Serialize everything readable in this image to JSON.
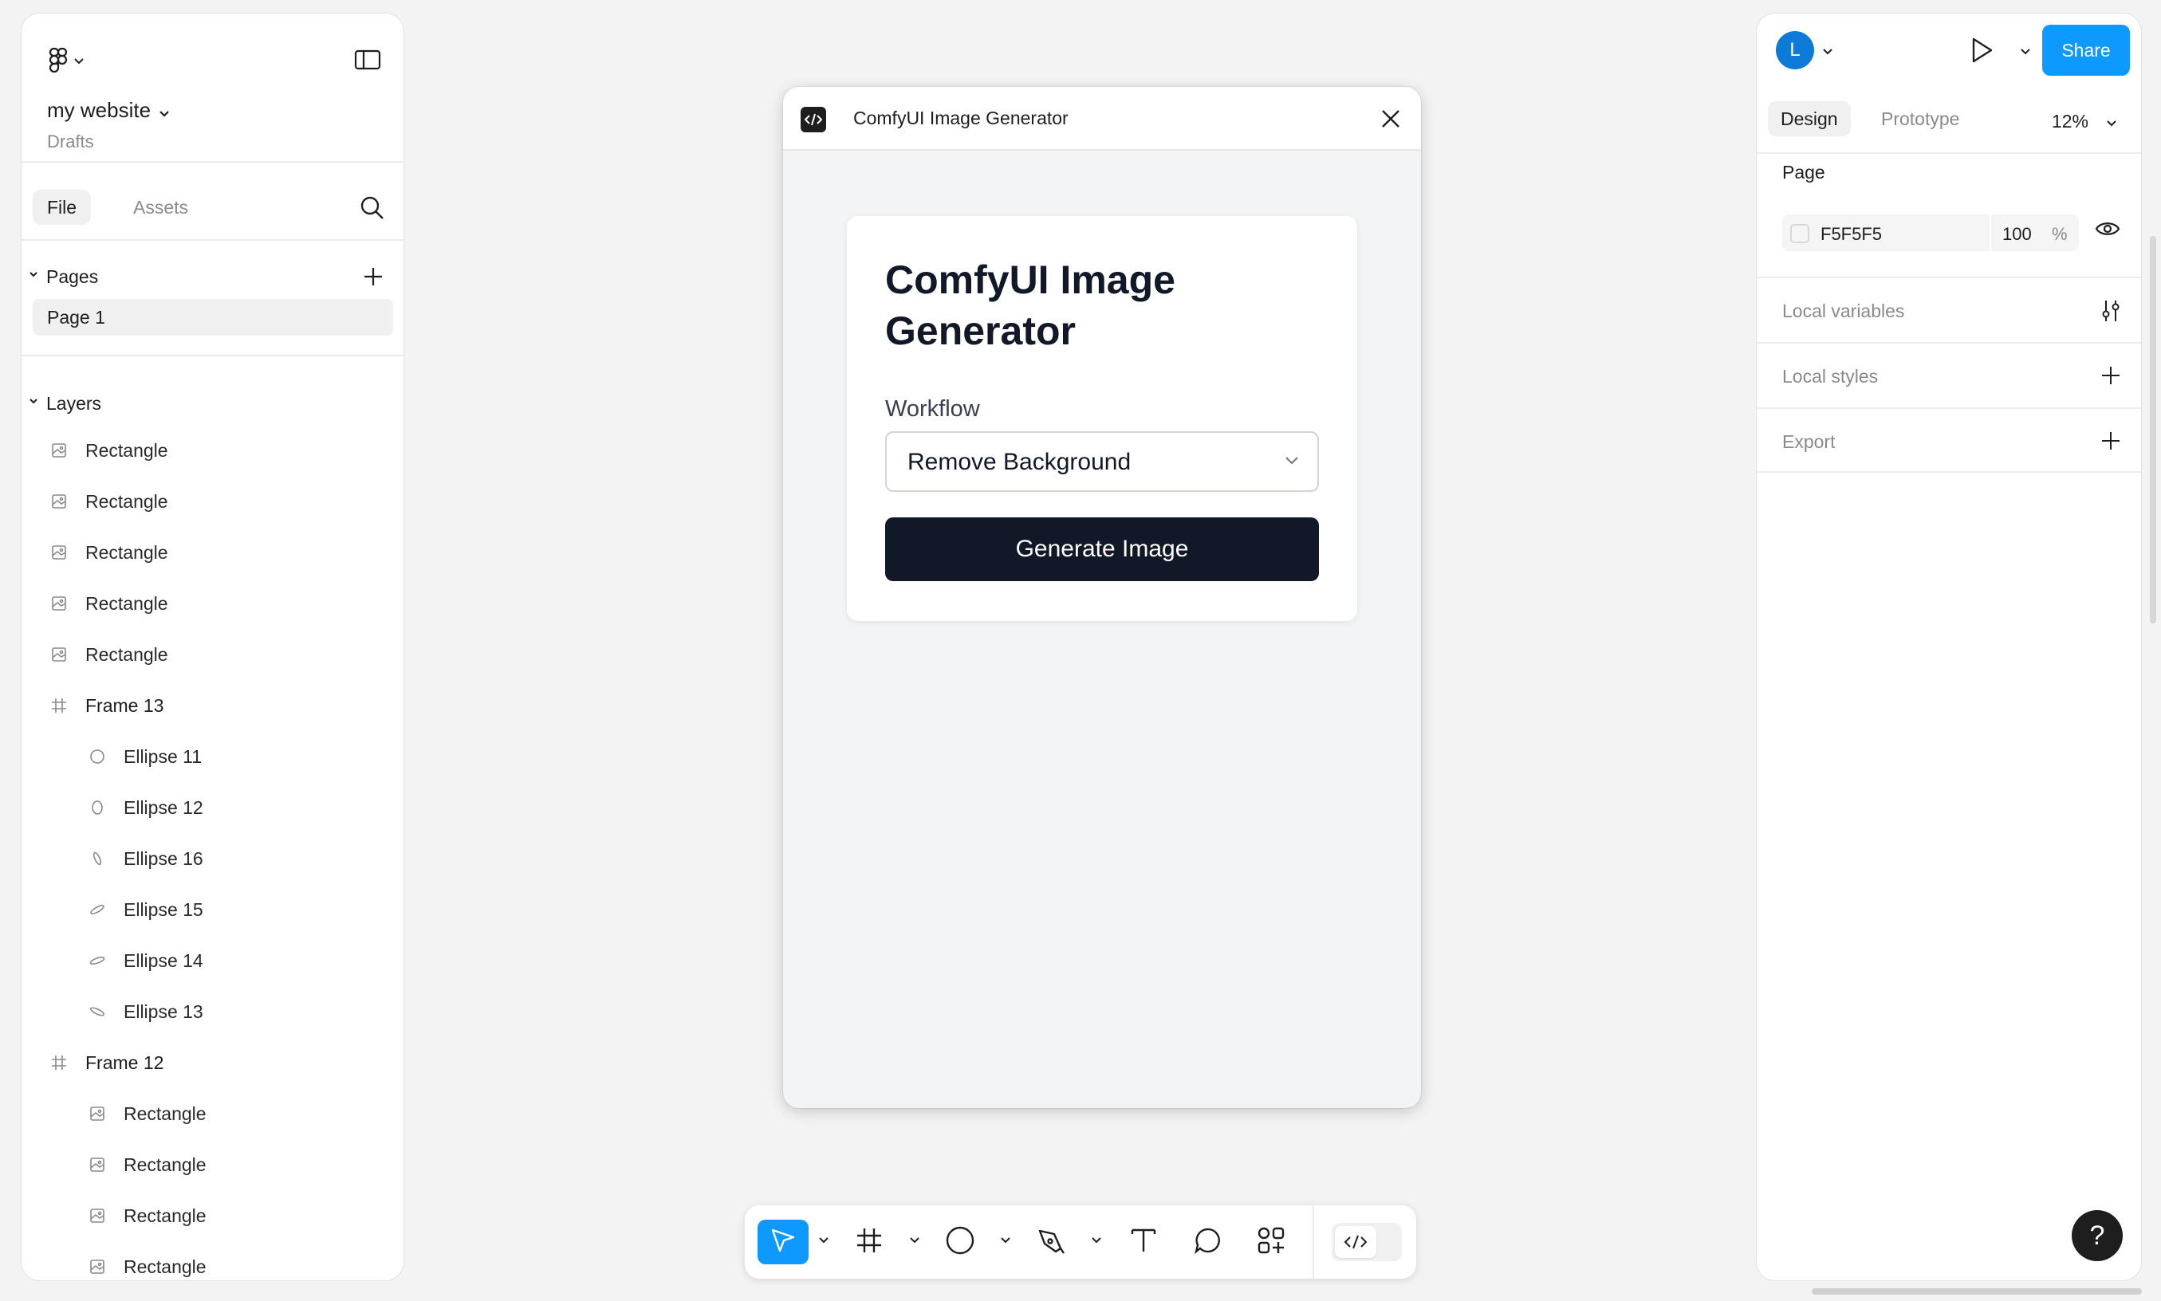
{
  "left_panel": {
    "file_name": "my website",
    "file_location": "Drafts",
    "tabs": [
      "File",
      "Assets"
    ],
    "pages_header": "Pages",
    "pages": [
      "Page 1"
    ],
    "layers_header": "Layers",
    "layers": [
      {
        "name": "Rectangle",
        "type": "image",
        "level": 0
      },
      {
        "name": "Rectangle",
        "type": "image",
        "level": 0
      },
      {
        "name": "Rectangle",
        "type": "image",
        "level": 0
      },
      {
        "name": "Rectangle",
        "type": "image",
        "level": 0
      },
      {
        "name": "Rectangle",
        "type": "image",
        "level": 0
      },
      {
        "name": "Frame 13",
        "type": "frame",
        "level": 0
      },
      {
        "name": "Ellipse 11",
        "type": "ellipse",
        "level": 1
      },
      {
        "name": "Ellipse 12",
        "type": "ellipse",
        "level": 1
      },
      {
        "name": "Ellipse 16",
        "type": "ellipse",
        "level": 1
      },
      {
        "name": "Ellipse 15",
        "type": "ellipse",
        "level": 1
      },
      {
        "name": "Ellipse 14",
        "type": "ellipse",
        "level": 1
      },
      {
        "name": "Ellipse 13",
        "type": "ellipse",
        "level": 1
      },
      {
        "name": "Frame 12",
        "type": "frame",
        "level": 0
      },
      {
        "name": "Rectangle",
        "type": "image",
        "level": 1
      },
      {
        "name": "Rectangle",
        "type": "image",
        "level": 1
      },
      {
        "name": "Rectangle",
        "type": "image",
        "level": 1
      },
      {
        "name": "Rectangle",
        "type": "image",
        "level": 1
      }
    ]
  },
  "preview": {
    "window_title": "ComfyUI Image Generator",
    "card_title": "ComfyUI Image Generator",
    "workflow_label": "Workflow",
    "workflow_value": "Remove Background",
    "generate_label": "Generate Image"
  },
  "right_panel": {
    "avatar_initial": "L",
    "share_label": "Share",
    "tabs": [
      "Design",
      "Prototype"
    ],
    "zoom": "12%",
    "page_section": "Page",
    "background_hex": "F5F5F5",
    "background_opacity": "100",
    "opacity_unit": "%",
    "rows": [
      "Local variables",
      "Local styles",
      "Export"
    ]
  },
  "help_label": "?",
  "colors": {
    "accent": "#0d99ff",
    "dark_button": "#111827",
    "canvas_bg": "#f3f3f3",
    "avatar": "#0d7ad8"
  },
  "icons": {
    "toolbar": [
      "move-icon",
      "frame-icon",
      "ellipse-icon",
      "pen-icon",
      "text-icon",
      "comment-icon",
      "actions-icon",
      "dev-mode-icon"
    ]
  }
}
